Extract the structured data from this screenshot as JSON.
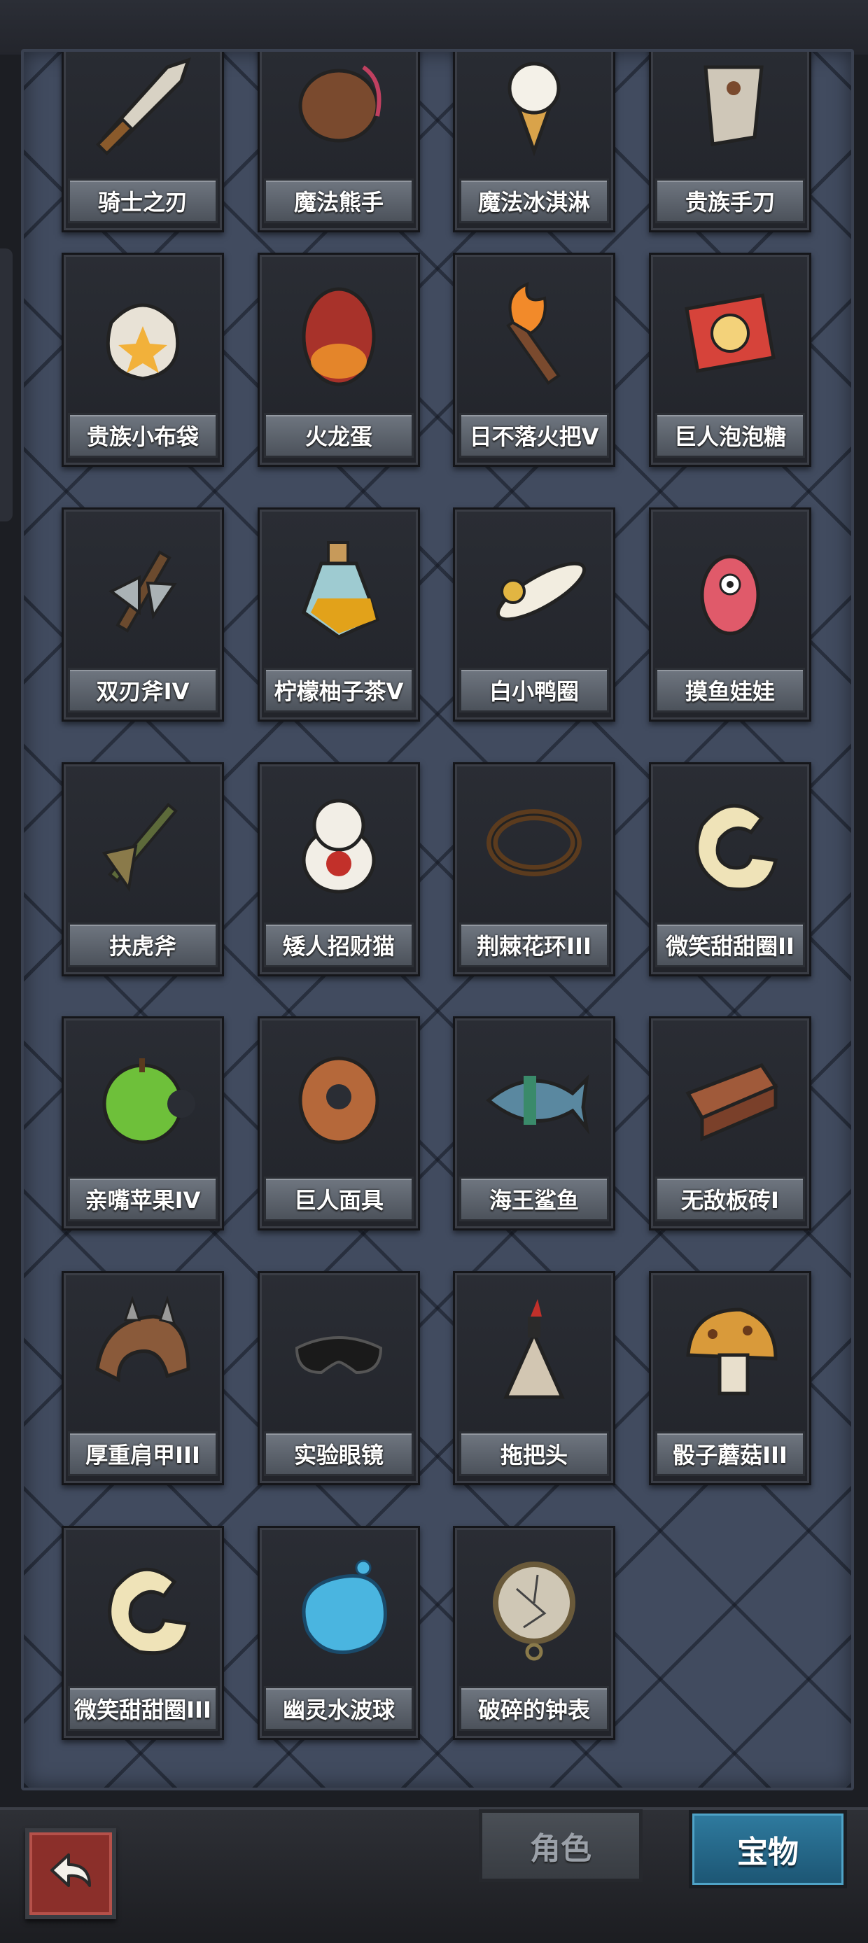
{
  "items": [
    {
      "name": "骑士之刃",
      "icon": "knight-blade-icon"
    },
    {
      "name": "魔法熊手",
      "icon": "magic-bear-paw-icon"
    },
    {
      "name": "魔法冰淇淋",
      "icon": "ice-cream-icon"
    },
    {
      "name": "贵族手刀",
      "icon": "noble-hand-blade-icon"
    },
    {
      "name": "贵族小布袋",
      "icon": "cloth-pouch-icon"
    },
    {
      "name": "火龙蛋",
      "icon": "fire-dragon-egg-icon"
    },
    {
      "name": "日不落火把V",
      "icon": "torch-icon"
    },
    {
      "name": "巨人泡泡糖",
      "icon": "bubble-gum-box-icon"
    },
    {
      "name": "双刃斧IV",
      "icon": "double-axe-icon"
    },
    {
      "name": "柠檬柚子茶V",
      "icon": "potion-bottle-icon"
    },
    {
      "name": "白小鸭圈",
      "icon": "duck-float-icon"
    },
    {
      "name": "摸鱼娃娃",
      "icon": "pink-doll-icon"
    },
    {
      "name": "扶虎斧",
      "icon": "tiger-axe-icon"
    },
    {
      "name": "矮人招财猫",
      "icon": "lucky-cat-icon"
    },
    {
      "name": "荆棘花环III",
      "icon": "thorn-wreath-icon"
    },
    {
      "name": "微笑甜甜圈II",
      "icon": "donut-icon"
    },
    {
      "name": "亲嘴苹果IV",
      "icon": "bitten-apple-icon"
    },
    {
      "name": "巨人面具",
      "icon": "giant-mask-icon"
    },
    {
      "name": "海王鲨鱼",
      "icon": "shark-icon"
    },
    {
      "name": "无敌板砖I",
      "icon": "brick-icon"
    },
    {
      "name": "厚重肩甲III",
      "icon": "shoulder-armor-icon"
    },
    {
      "name": "实验眼镜",
      "icon": "goggles-icon"
    },
    {
      "name": "拖把头",
      "icon": "mop-head-icon"
    },
    {
      "name": "骰子蘑菇III",
      "icon": "dice-mushroom-icon"
    },
    {
      "name": "微笑甜甜圈III",
      "icon": "donut-icon"
    },
    {
      "name": "幽灵水波球",
      "icon": "water-ball-icon"
    },
    {
      "name": "破碎的钟表",
      "icon": "broken-clock-icon"
    }
  ],
  "bottom_bar": {
    "back_icon": "back-arrow-icon",
    "tabs": [
      {
        "label": "角色",
        "active": false
      },
      {
        "label": "宝物",
        "active": true
      }
    ]
  },
  "colors": {
    "panel_bg": "#414b5f",
    "active_tab": "#2f7b9f",
    "back_button": "#8b2f2a"
  }
}
